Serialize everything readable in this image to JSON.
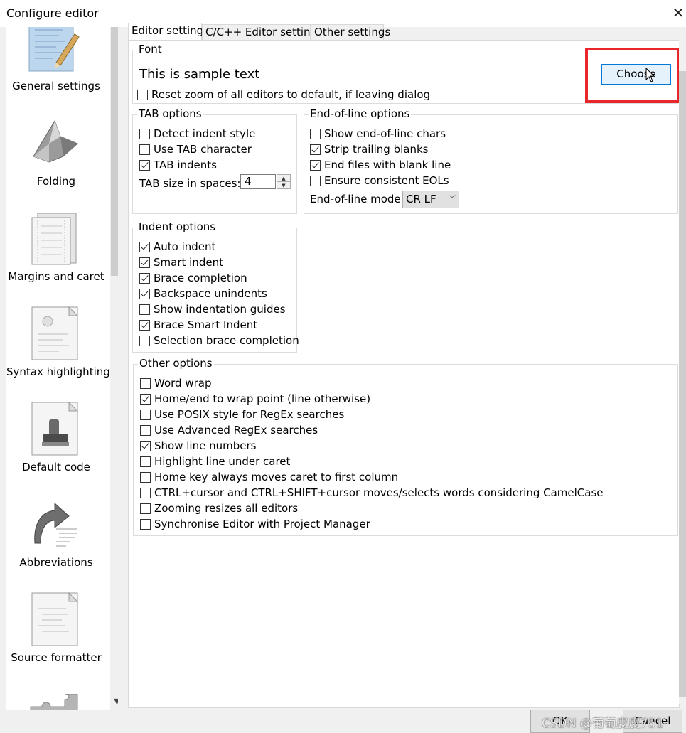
{
  "window": {
    "title": "Configure editor",
    "close_glyph": "✕"
  },
  "sidebar": {
    "items": [
      {
        "label": "General settings",
        "icon": "general-settings-icon",
        "selected": true
      },
      {
        "label": "Folding",
        "icon": "folding-icon"
      },
      {
        "label": "Margins and caret",
        "icon": "margins-caret-icon"
      },
      {
        "label": "Syntax highlighting",
        "icon": "syntax-highlighting-icon"
      },
      {
        "label": "Default code",
        "icon": "default-code-icon"
      },
      {
        "label": "Abbreviations",
        "icon": "abbreviations-icon"
      },
      {
        "label": "Source formatter",
        "icon": "source-formatter-icon"
      }
    ]
  },
  "tabs": [
    {
      "label": "Editor settings",
      "active": true
    },
    {
      "label": "C/C++ Editor settings"
    },
    {
      "label": "Other settings"
    }
  ],
  "font": {
    "title": "Font",
    "sample": "This is sample text",
    "choose_label": "Choose",
    "reset_zoom": {
      "label": "Reset zoom of all editors to default, if leaving dialog",
      "checked": false
    }
  },
  "tab_options": {
    "title": "TAB options",
    "items": [
      {
        "label": "Detect indent style",
        "checked": false
      },
      {
        "label": "Use TAB character",
        "checked": false
      },
      {
        "label": "TAB indents",
        "checked": true
      }
    ],
    "tab_size_label": "TAB size in spaces:",
    "tab_size_value": "4"
  },
  "eol_options": {
    "title": "End-of-line options",
    "items": [
      {
        "label": "Show end-of-line chars",
        "checked": false
      },
      {
        "label": "Strip trailing blanks",
        "checked": true
      },
      {
        "label": "End files with blank line",
        "checked": true
      },
      {
        "label": "Ensure consistent EOLs",
        "checked": false
      }
    ],
    "mode_label": "End-of-line mode:",
    "mode_value": "CR LF"
  },
  "indent_options": {
    "title": "Indent options",
    "items": [
      {
        "label": "Auto indent",
        "checked": true
      },
      {
        "label": "Smart indent",
        "checked": true
      },
      {
        "label": "Brace completion",
        "checked": true
      },
      {
        "label": "Backspace unindents",
        "checked": true
      },
      {
        "label": "Show indentation guides",
        "checked": false
      },
      {
        "label": "Brace Smart Indent",
        "checked": true
      },
      {
        "label": "Selection brace completion",
        "checked": false
      }
    ]
  },
  "other_options": {
    "title": "Other options",
    "items": [
      {
        "label": "Word wrap",
        "checked": false
      },
      {
        "label": "Home/end to wrap point (line otherwise)",
        "checked": true
      },
      {
        "label": "Use POSIX style for RegEx searches",
        "checked": false
      },
      {
        "label": "Use Advanced RegEx searches",
        "checked": false
      },
      {
        "label": "Show line numbers",
        "checked": true
      },
      {
        "label": "Highlight line under caret",
        "checked": false
      },
      {
        "label": "Home key always moves caret to first column",
        "checked": false
      },
      {
        "label": "CTRL+cursor and CTRL+SHIFT+cursor moves/selects words considering CamelCase",
        "checked": false
      },
      {
        "label": "Zooming resizes all editors",
        "checked": false
      },
      {
        "label": "Synchronise Editor with Project Manager",
        "checked": false
      }
    ]
  },
  "footer": {
    "ok_label": "OK",
    "cancel_label": "Cancel"
  },
  "watermark": "CSDN @葡萄皮皮751",
  "colors": {
    "highlight_box": "#e8262b",
    "button_focus": "#0078d7",
    "button_bg": "#e5f1fb"
  }
}
